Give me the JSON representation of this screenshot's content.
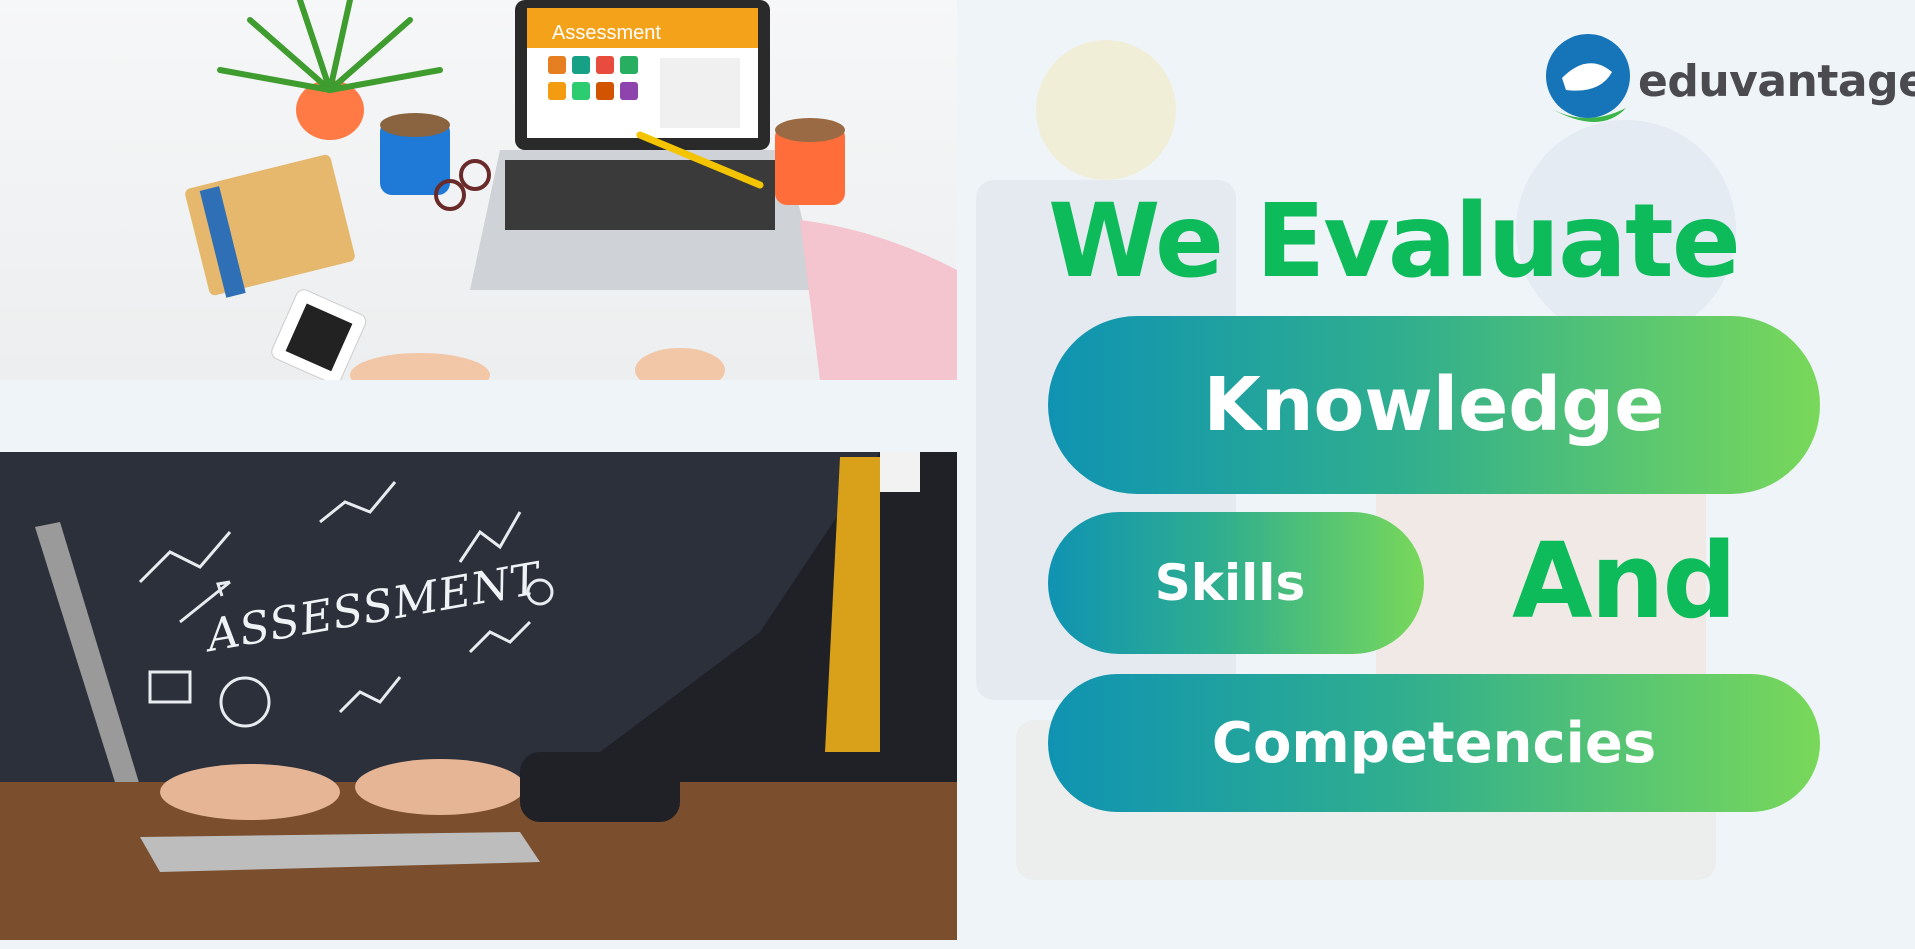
{
  "logo": {
    "text": "eduvantage",
    "icon": "eduvantage-logo-icon"
  },
  "headline": "We Evaluate",
  "pills": {
    "knowledge": "Knowledge",
    "skills": "Skills",
    "competencies": "Competencies"
  },
  "conjunction": "And",
  "images": {
    "top_screen_title": "Assessment",
    "bottom_chalk_text": "ASSESSMENT"
  },
  "colors": {
    "headline_green": "#0dbb5b",
    "pill_gradient_start": "#0f93b2",
    "pill_gradient_end": "#79d85a",
    "logo_blue": "#1674b9",
    "logo_green": "#39b54a"
  }
}
